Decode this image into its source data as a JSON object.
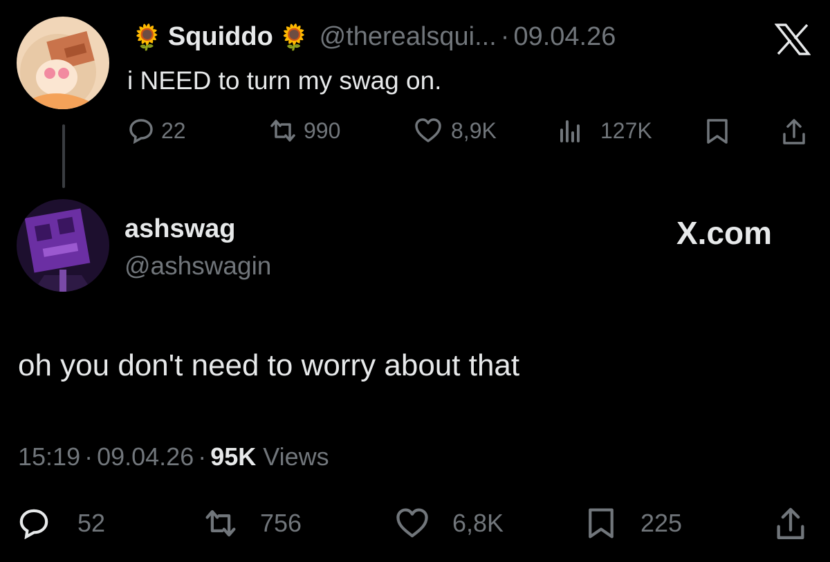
{
  "parent_tweet": {
    "display_name": "Squiddo",
    "name_emoji": "🌻",
    "handle": "@therealsqui...",
    "separator": "·",
    "date": "09.04.26",
    "text": "i NEED to turn my swag on.",
    "stats": {
      "replies": "22",
      "reposts": "990",
      "likes": "8,9K",
      "views": "127K"
    }
  },
  "reply_tweet": {
    "display_name": "ashswag",
    "handle": "@ashswagin",
    "text": "oh you don't need to worry about that",
    "time": "15:19",
    "separator": "·",
    "date": "09.04.26",
    "views_count": "95K",
    "views_label": "Views",
    "stats": {
      "replies": "52",
      "reposts": "756",
      "likes": "6,8K",
      "bookmarks": "225"
    }
  },
  "brand": {
    "logo": "X",
    "watermark": "X.com"
  },
  "colors": {
    "background": "#000000",
    "text": "#e7e9ea",
    "muted": "#71767b"
  }
}
